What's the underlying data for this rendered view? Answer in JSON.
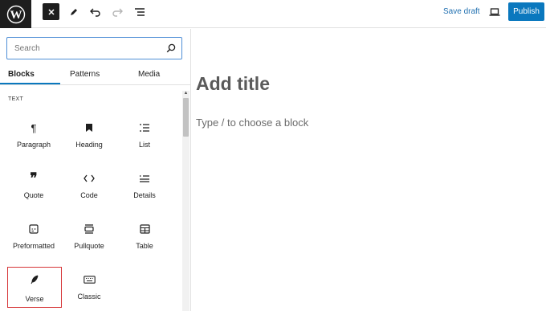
{
  "toolbar": {
    "save_draft": "Save draft",
    "publish": "Publish"
  },
  "inserter": {
    "search_placeholder": "Search",
    "tabs": [
      {
        "label": "Blocks",
        "active": true
      },
      {
        "label": "Patterns",
        "active": false
      },
      {
        "label": "Media",
        "active": false
      }
    ],
    "category": "TEXT",
    "blocks": [
      {
        "label": "Paragraph",
        "icon": "pilcrow-icon"
      },
      {
        "label": "Heading",
        "icon": "bookmark-icon"
      },
      {
        "label": "List",
        "icon": "list-icon"
      },
      {
        "label": "Quote",
        "icon": "quote-icon"
      },
      {
        "label": "Code",
        "icon": "code-icon"
      },
      {
        "label": "Details",
        "icon": "details-icon"
      },
      {
        "label": "Preformatted",
        "icon": "preformatted-icon"
      },
      {
        "label": "Pullquote",
        "icon": "pullquote-icon"
      },
      {
        "label": "Table",
        "icon": "table-icon"
      },
      {
        "label": "Verse",
        "icon": "feather-icon",
        "highlighted": true
      },
      {
        "label": "Classic",
        "icon": "keyboard-icon"
      }
    ]
  },
  "editor": {
    "title_placeholder": "Add title",
    "block_hint": "Type / to choose a block"
  },
  "colors": {
    "accent": "#0a78be",
    "link": "#2271b1",
    "highlight": "#d63638"
  }
}
